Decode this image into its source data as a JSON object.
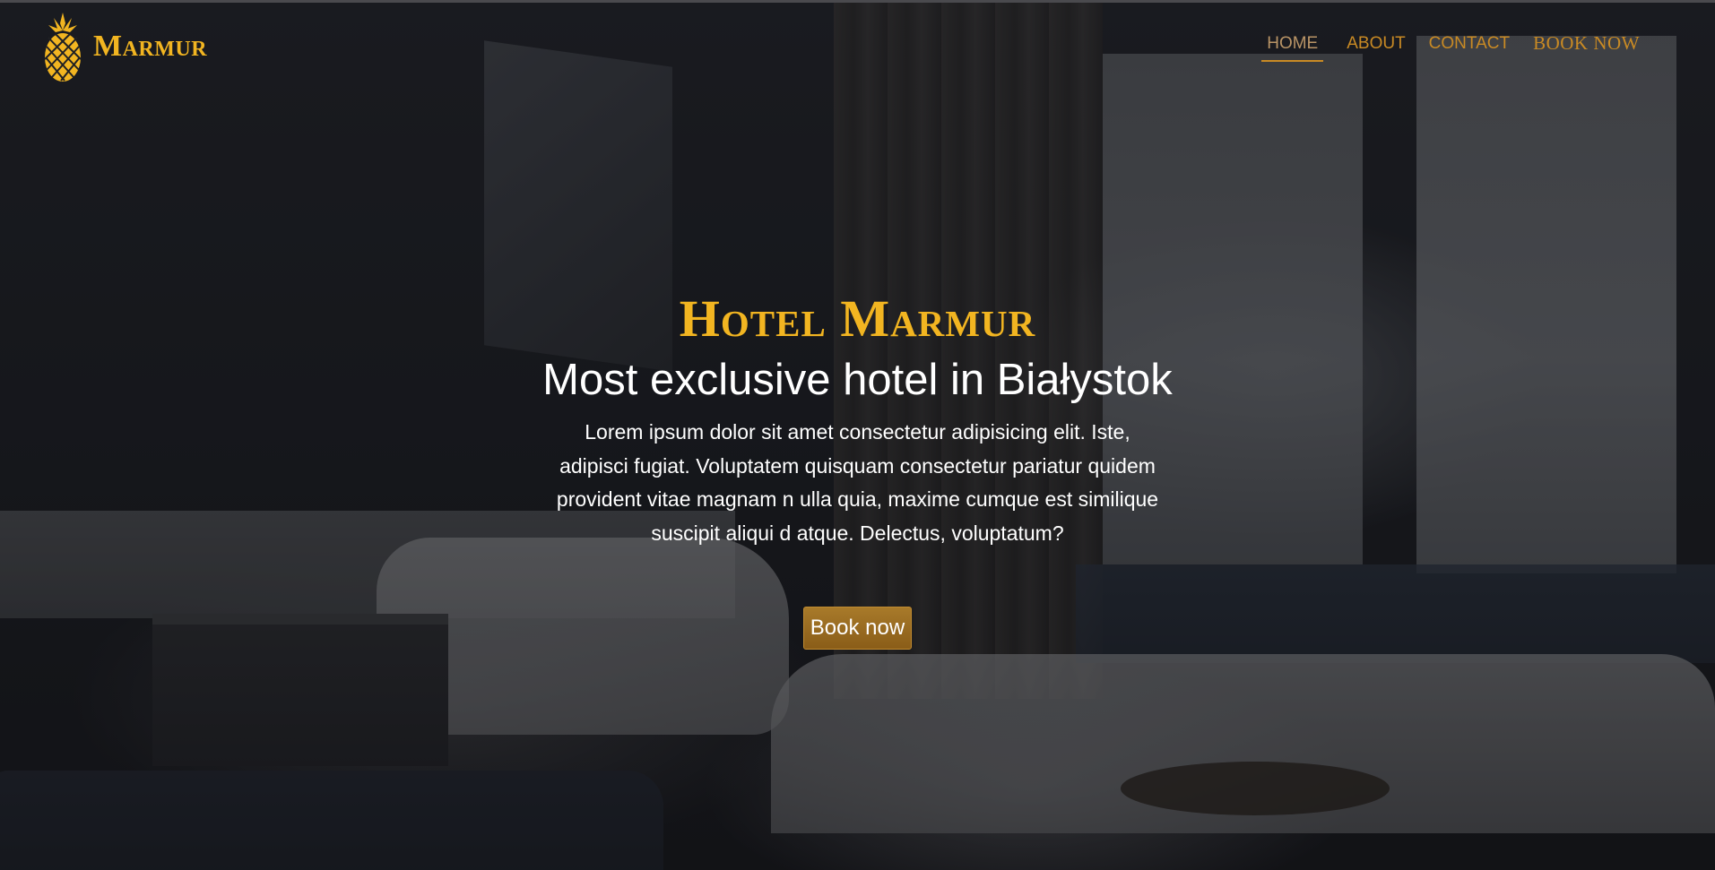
{
  "brand": {
    "name": "Marmur",
    "icon": "pineapple-icon",
    "color": "#f2b521"
  },
  "nav": {
    "items": [
      {
        "label": "HOME",
        "active": true
      },
      {
        "label": "ABOUT",
        "active": false
      },
      {
        "label": "CONTACT",
        "active": false
      },
      {
        "label": "BOOK NOW",
        "active": false
      }
    ],
    "accent_color": "#c98a24"
  },
  "hero": {
    "title": "Hotel Marmur",
    "subtitle": "Most exclusive hotel in Białystok",
    "description": "Lorem ipsum dolor sit amet consectetur adipisicing elit. Iste, adipisci fugiat. Voluptatem quisquam consectetur pariatur quidem provident vitae magnam n ulla quia, maxime cumque est similique suscipit aliqui d atque. Delectus, voluptatum?",
    "button_label": "Book now",
    "background": "dimmed hotel bedroom photo"
  }
}
